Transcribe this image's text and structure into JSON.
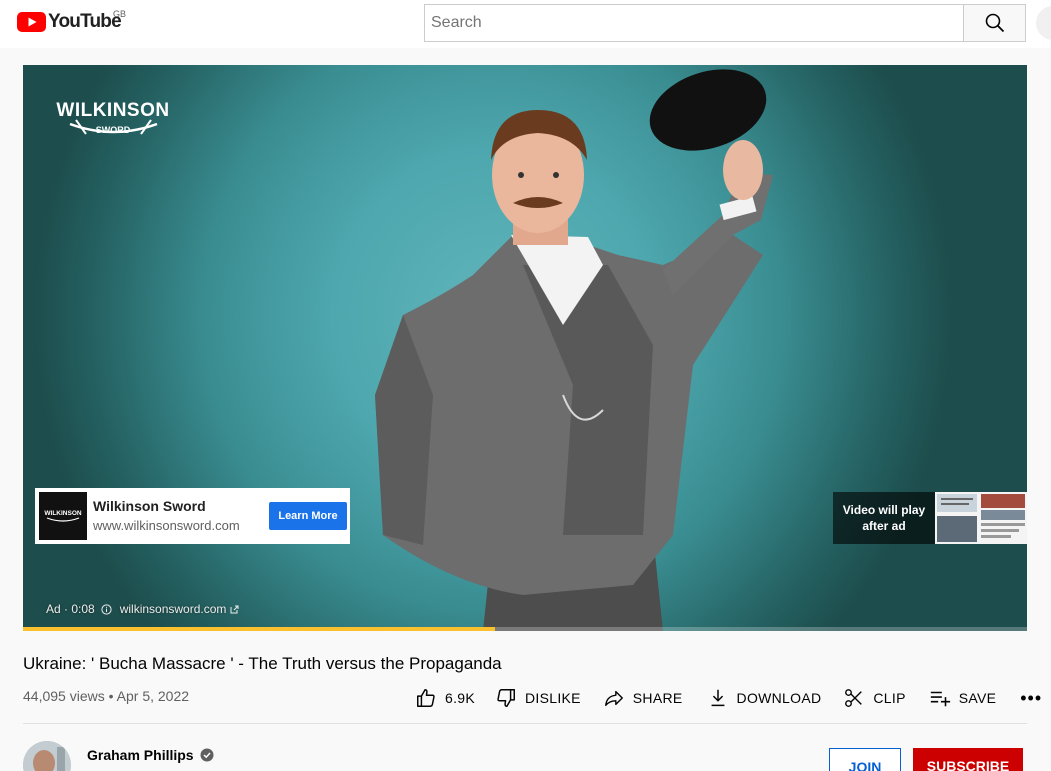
{
  "masthead": {
    "logo_text": "YouTube",
    "country_code": "GB",
    "search_placeholder": "Search"
  },
  "player": {
    "brand_logo_text": "WILKINSON",
    "brand_logo_subtext": "SWORD",
    "ad_card": {
      "title": "Wilkinson Sword",
      "url": "www.wilkinsonsword.com",
      "button": "Learn More"
    },
    "skip": {
      "line1": "Video will play",
      "line2": "after ad"
    },
    "ad_info": {
      "label": "Ad · 0:08",
      "domain": "wilkinsonsword.com"
    },
    "progress_percent": 47
  },
  "video": {
    "title": "Ukraine: ' Bucha Massacre ' - The Truth versus the Propaganda",
    "views": "44,095 views",
    "date": "Apr 5, 2022"
  },
  "actions": {
    "like_count": "6.9K",
    "dislike": "DISLIKE",
    "share": "SHARE",
    "download": "DOWNLOAD",
    "clip": "CLIP",
    "save": "SAVE",
    "more": "•••"
  },
  "channel": {
    "name": "Graham Phillips",
    "join": "JOIN",
    "subscribe": "SUBSCRIBE"
  },
  "colors": {
    "brand_red": "#ff0000",
    "subscribe_red": "#cc0000",
    "link_blue": "#065fd4",
    "ad_button_blue": "#1a73e8",
    "ad_progress_yellow": "#fbc02d",
    "player_teal": "#4ea7ae"
  },
  "icons": {
    "search": "search-icon",
    "like": "thumbs-up-icon",
    "dislike": "thumbs-down-icon",
    "share": "share-arrow-icon",
    "download": "download-icon",
    "clip": "scissors-icon",
    "save": "playlist-add-icon",
    "verified": "verified-check-icon",
    "info": "info-icon",
    "external": "external-link-icon"
  }
}
